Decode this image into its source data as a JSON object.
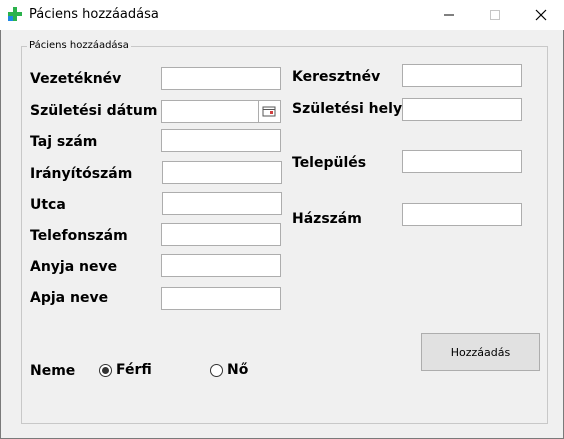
{
  "window": {
    "title": "Páciens hozzáadása",
    "icon": "medical-cross-icon"
  },
  "group": {
    "legend": "Páciens hozzáadása"
  },
  "form": {
    "vezeteknev_label": "Vezetéknév",
    "vezeteknev_value": "",
    "szuletesi_datum_label": "Születési dátum",
    "szuletesi_datum_value": "",
    "taj_label": "Taj szám",
    "taj_value": "",
    "iranyitoszam_label": "Irányítószám",
    "iranyitoszam_value": "",
    "utca_label": "Utca",
    "utca_value": "",
    "telefon_label": "Telefonszám",
    "telefon_value": "",
    "anyja_label": "Anyja neve",
    "anyja_value": "",
    "apja_label": "Apja neve",
    "apja_value": "",
    "keresztnev_label": "Keresztnév",
    "keresztnev_value": "",
    "szuletesi_hely_label": "Születési hely",
    "szuletesi_hely_value": "",
    "telepules_label": "Település",
    "telepules_value": "",
    "hazszam_label": "Házszám",
    "hazszam_value": ""
  },
  "gender": {
    "label": "Neme",
    "options": [
      {
        "label": "Férfi",
        "selected": true
      },
      {
        "label": "Nő",
        "selected": false
      }
    ]
  },
  "buttons": {
    "add_label": "Hozzáadás"
  },
  "colors": {
    "icon_green": "#2bb24c",
    "icon_blue": "#1e88e5"
  }
}
